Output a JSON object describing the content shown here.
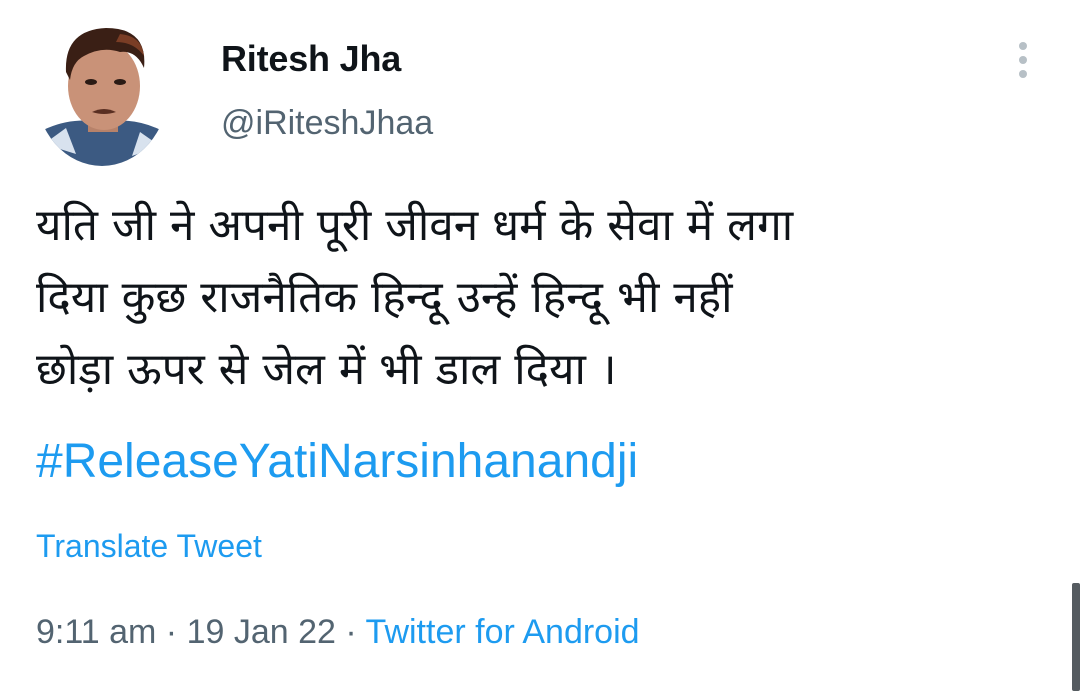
{
  "author": {
    "display_name": "Ritesh Jha",
    "handle": "@iRiteshJhaa"
  },
  "tweet": {
    "text_lines": [
      "यति जी ने अपनी पूरी जीवन धर्म के सेवा में लगा",
      "दिया कुछ राजनैतिक हिन्दू उन्हें हिन्दू भी नहीं",
      "छोड़ा ऊपर से जेल में भी डाल दिया ।"
    ],
    "hashtag": "#ReleaseYatiNarsinhanandji",
    "translate_label": "Translate Tweet"
  },
  "meta": {
    "time": "9:11 am",
    "date": "19 Jan 22",
    "separator": "·",
    "source": "Twitter for Android"
  },
  "icons": {
    "more": "more-vertical-icon",
    "avatar": "profile-photo"
  },
  "colors": {
    "accent": "#1d9bf0",
    "secondary_text": "#536471",
    "primary_text": "#0f1419"
  }
}
